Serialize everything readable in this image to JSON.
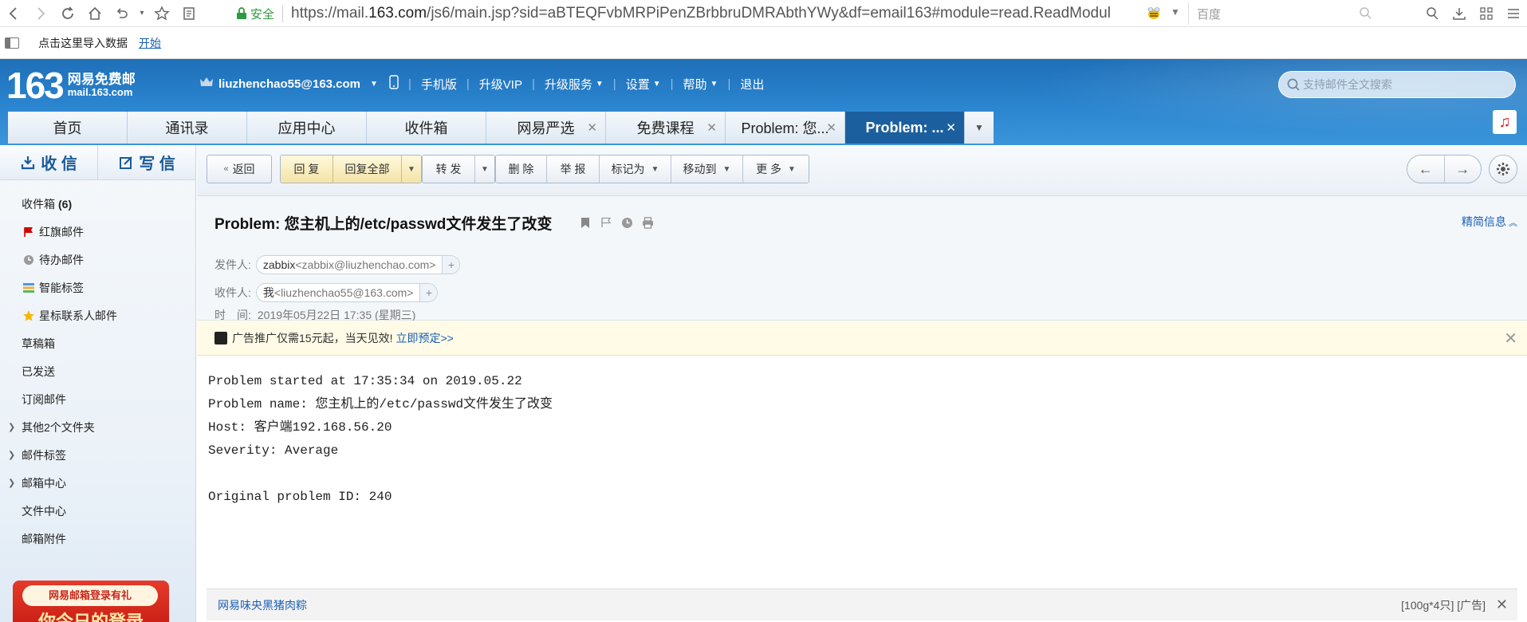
{
  "browser": {
    "secure_label": "安全",
    "url_prefix": "https://mail.",
    "url_domain": "163.com",
    "url_rest": "/js6/main.jsp?sid=aBTEQFvbMRPiPenZBrbbruDMRAbthYWy&df=email163#module=read.ReadModul",
    "search_placeholder": "百度"
  },
  "bookmarks": {
    "import_text": "点击这里导入数据",
    "start_link": "开始"
  },
  "header": {
    "logo_number": "163",
    "logo_name": "网易免费邮",
    "logo_domain": "mail.163.com",
    "username": "liuzhenchao55@163.com",
    "nav": [
      "手机版",
      "升级VIP",
      "升级服务",
      "设置",
      "帮助",
      "退出"
    ],
    "search_placeholder": "支持邮件全文搜索"
  },
  "tabs": [
    {
      "label": "首页",
      "closable": false,
      "active": false
    },
    {
      "label": "通讯录",
      "closable": false,
      "active": false
    },
    {
      "label": "应用中心",
      "closable": false,
      "active": false
    },
    {
      "label": "收件箱",
      "closable": false,
      "active": false
    },
    {
      "label": "网易严选",
      "closable": true,
      "active": false
    },
    {
      "label": "免费课程",
      "closable": true,
      "active": false
    },
    {
      "label": "Problem: 您...",
      "closable": true,
      "active": false
    },
    {
      "label": "Problem: ...",
      "closable": true,
      "active": true
    }
  ],
  "sidebar": {
    "receive_label": "收 信",
    "compose_label": "写 信",
    "folders": [
      {
        "label": "收件箱",
        "count": "(6)",
        "icon": "none",
        "expandable": false
      },
      {
        "label": "红旗邮件",
        "icon": "red-flag-icon",
        "expandable": false
      },
      {
        "label": "待办邮件",
        "icon": "clock-icon",
        "expandable": false
      },
      {
        "label": "智能标签",
        "icon": "tag-stack-icon",
        "expandable": false
      },
      {
        "label": "星标联系人邮件",
        "icon": "star-icon",
        "expandable": false
      },
      {
        "label": "草稿箱",
        "icon": "none",
        "expandable": false
      },
      {
        "label": "已发送",
        "icon": "none",
        "expandable": false
      },
      {
        "label": "订阅邮件",
        "icon": "none",
        "expandable": false
      },
      {
        "label": "其他2个文件夹",
        "icon": "none",
        "expandable": true
      },
      {
        "label": "邮件标签",
        "icon": "none",
        "expandable": true
      },
      {
        "label": "邮箱中心",
        "icon": "none",
        "expandable": true
      },
      {
        "label": "文件中心",
        "icon": "none",
        "expandable": false
      },
      {
        "label": "邮箱附件",
        "icon": "none",
        "expandable": false
      }
    ],
    "promo_line1": "网易邮箱登录有礼",
    "promo_line2": "你今日的登录"
  },
  "toolbar": {
    "back": "返回",
    "reply": "回 复",
    "reply_all": "回复全部",
    "forward": "转 发",
    "delete": "删 除",
    "report": "举 报",
    "mark_as": "标记为",
    "move_to": "移动到",
    "more": "更 多"
  },
  "mail": {
    "subject": "Problem: 您主机上的/etc/passwd文件发生了改变",
    "detail_link": "精简信息",
    "from_label": "发件人:",
    "from_name": "zabbix",
    "from_email": "<zabbix@liuzhenchao.com>",
    "to_label": "收件人:",
    "to_name": "我",
    "to_email": "<liuzhenchao55@163.com>",
    "time_label": "时　间:",
    "time_value": "2019年05月22日 17:35 (星期三)",
    "ad_text": "广告推广仅需15元起，当天见效!",
    "ad_link": "立即预定>>",
    "body": "Problem started at 17:35:34 on 2019.05.22\nProblem name: 您主机上的/etc/passwd文件发生了改变\nHost: 客户端192.168.56.20\nSeverity: Average\n\nOriginal problem ID: 240"
  },
  "bottom_ad": {
    "left_text": "网易味央黑猪肉粽",
    "right_text": "[100g*4只] [广告]"
  },
  "colors": {
    "header_blue": "#2b85cf",
    "active_tab": "#1c5f9e",
    "link": "#1a5fb4"
  }
}
